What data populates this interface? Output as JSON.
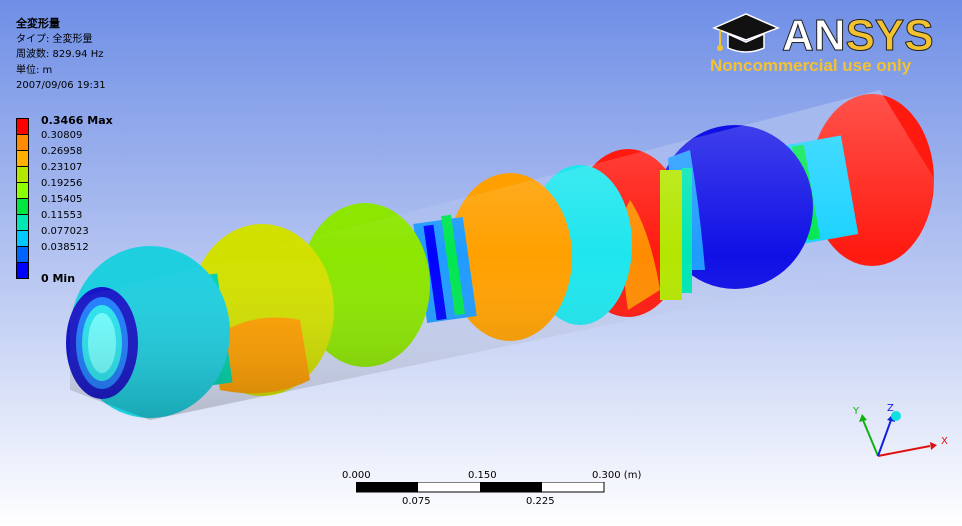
{
  "info": {
    "title": "全変形量",
    "type_line": "タイプ: 全変形量",
    "freq_line": "周波数: 829.94 Hz",
    "unit_line": "単位: m",
    "date_line": "2007/09/06 19:31"
  },
  "legend": {
    "items": [
      {
        "label": "0.3466 Max",
        "color": "#ff0000"
      },
      {
        "label": "0.30809",
        "color": "#ff8c00"
      },
      {
        "label": "0.26958",
        "color": "#ffb000"
      },
      {
        "label": "0.23107",
        "color": "#b4e600"
      },
      {
        "label": "0.19256",
        "color": "#8cff00"
      },
      {
        "label": "0.15405",
        "color": "#00e640"
      },
      {
        "label": "0.11553",
        "color": "#00e6b4"
      },
      {
        "label": "0.077023",
        "color": "#00c8ff"
      },
      {
        "label": "0.038512",
        "color": "#0064ff"
      },
      {
        "label": "0 Min",
        "color": "#0000ff"
      }
    ]
  },
  "logo": {
    "brand": "ANSYS",
    "notice": "Noncommercial use only"
  },
  "scale": {
    "top_ticks": [
      "0.000",
      "0.150",
      "0.300 (m)"
    ],
    "bottom_ticks": [
      "0.075",
      "0.225"
    ]
  },
  "triad": {
    "x": "X",
    "y": "Y",
    "z": "Z"
  }
}
